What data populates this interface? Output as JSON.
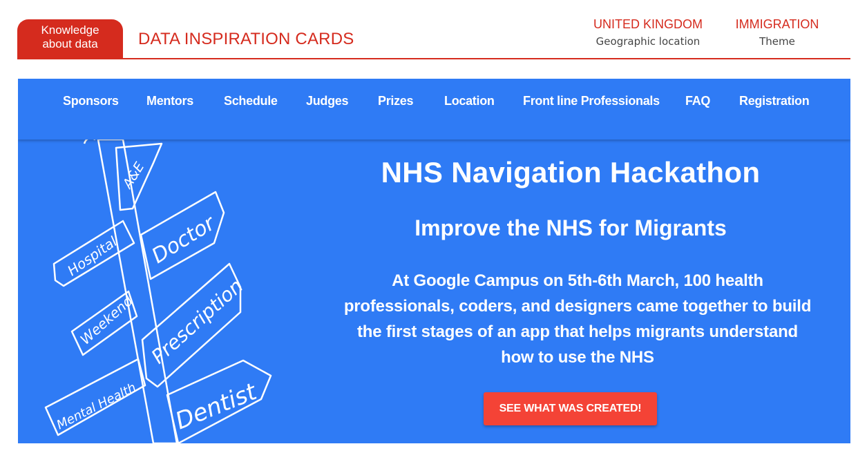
{
  "card": {
    "tag_line1": "Knowledge",
    "tag_line2": "about data",
    "title": "DATA INSPIRATION CARDS",
    "location_value": "UNITED KINGDOM",
    "location_label": "Geographic location",
    "theme_value": "IMMIGRATION",
    "theme_label": "Theme",
    "accent_color": "#d52b1e"
  },
  "site": {
    "nav": [
      "Sponsors",
      "Mentors",
      "Schedule",
      "Judges",
      "Prizes",
      "Location",
      "Front line Professionals",
      "FAQ",
      "Registration"
    ],
    "signposts": [
      "A&E",
      "Hospital",
      "Doctor",
      "Weekend",
      "Prescription",
      "Mental Health",
      "Dentist"
    ],
    "hero": {
      "title": "NHS Navigation Hackathon",
      "subtitle": "Improve the NHS for Migrants",
      "body_line1": "At Google Campus on 5th-6th March, 100 health",
      "body_line2": "professionals, coders, and designers came together to  build",
      "body_line3": "the first stages of an app that helps migrants understand",
      "body_line4": "how to use the NHS",
      "cta_label": "SEE WHAT WAS CREATED!"
    },
    "background_color": "#2f7bf5",
    "cta_color": "#f44336"
  }
}
